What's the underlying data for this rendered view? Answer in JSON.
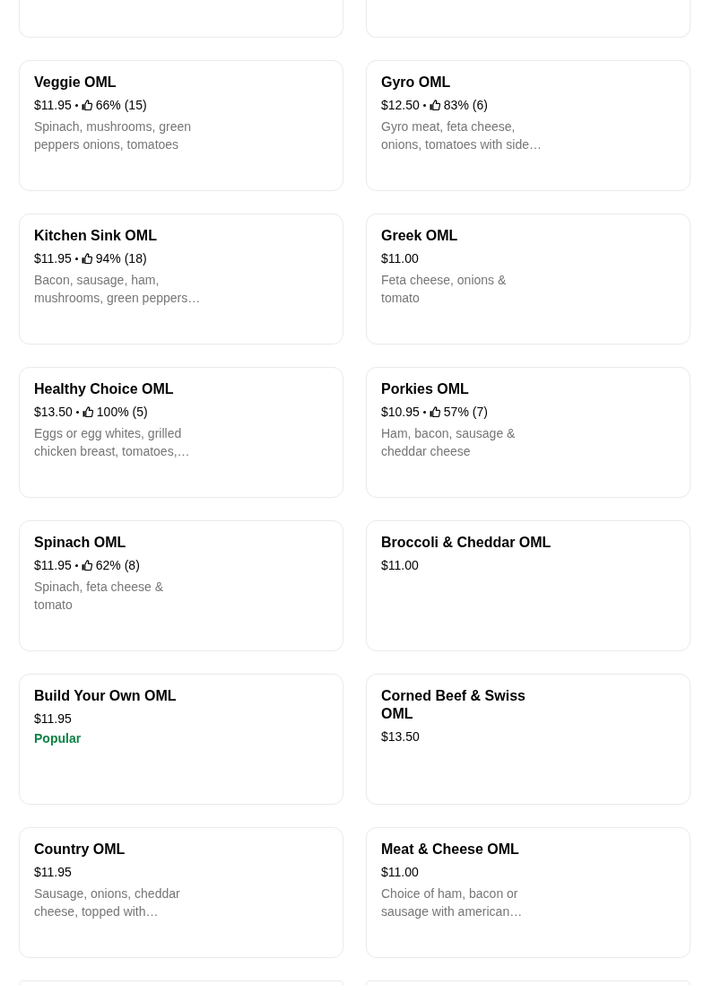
{
  "menu_items": [
    {
      "name": "Veggie OML",
      "price": "$11.95",
      "rating": "66% (15)",
      "description": "Spinach, mushrooms, green peppers onions, tomatoes"
    },
    {
      "name": "Gyro OML",
      "price": "$12.50",
      "rating": "83% (6)",
      "description": "Gyro meat, feta cheese, onions, tomatoes with side…"
    },
    {
      "name": "Kitchen Sink OML",
      "price": "$11.95",
      "rating": "94% (18)",
      "description": "Bacon, sausage, ham, mushrooms, green peppers…"
    },
    {
      "name": "Greek OML",
      "price": "$11.00",
      "description": "Feta cheese, onions & tomato"
    },
    {
      "name": "Healthy Choice OML",
      "price": "$13.50",
      "rating": "100% (5)",
      "description": "Eggs or egg whites, grilled chicken breast, tomatoes,…"
    },
    {
      "name": "Porkies OML",
      "price": "$10.95",
      "rating": "57% (7)",
      "description": "Ham, bacon, sausage & cheddar cheese"
    },
    {
      "name": "Spinach OML",
      "price": "$11.95",
      "rating": "62% (8)",
      "description": "Spinach, feta cheese & tomato"
    },
    {
      "name": "Broccoli & Cheddar OML",
      "price": "$11.00"
    },
    {
      "name": "Build Your Own OML",
      "price": "$11.95",
      "badge": "Popular"
    },
    {
      "name": "Corned Beef & Swiss OML",
      "price": "$13.50"
    },
    {
      "name": "Country OML",
      "price": "$11.95",
      "description": "Sausage, onions, cheddar cheese, topped with…"
    },
    {
      "name": "Meat & Cheese OML",
      "price": "$11.00",
      "description": "Choice of ham, bacon or sausage with american…"
    }
  ]
}
